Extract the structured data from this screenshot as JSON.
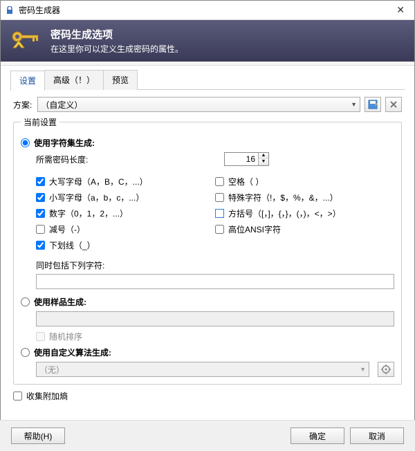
{
  "titlebar": {
    "title": "密码生成器"
  },
  "banner": {
    "heading": "密码生成选项",
    "sub": "在这里你可以定义生成密码的属性。"
  },
  "tabs": {
    "settings": "设置",
    "advanced": "高级（！）",
    "preview": "预览"
  },
  "profile": {
    "label": "方案:",
    "selected": "（自定义）"
  },
  "group": {
    "legend": "当前设置",
    "charset_radio": "使用字符集生成:",
    "length_label": "所需密码长度:",
    "length_value": "16",
    "upper": "大写字母（A，B，C，...）",
    "lower": "小写字母（a，b，c，...）",
    "digits": "数字（0，1，2，...）",
    "minus": "减号（-）",
    "underscore": "下划线（_）",
    "space": "空格（ ）",
    "special": "特殊字符（!，$，%，&，...）",
    "brackets": "方括号（[，]，{，}，(，)，<，>）",
    "highansi": "高位ANSI字符",
    "also_include": "同时包括下列字符:",
    "pattern_radio": "使用样品生成:",
    "pattern_random": "随机排序",
    "custom_radio": "使用自定义算法生成:",
    "custom_none": "（无）"
  },
  "collect": "收集附加熵",
  "buttons": {
    "help": "帮助(H)",
    "ok": "确定",
    "cancel": "取消"
  }
}
